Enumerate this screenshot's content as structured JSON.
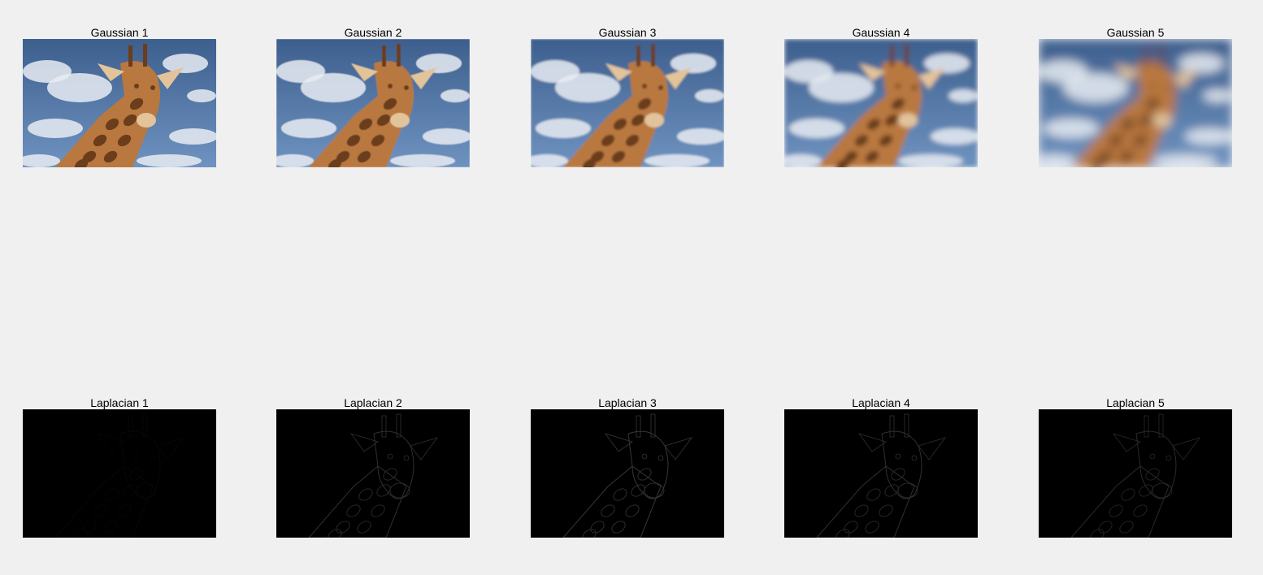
{
  "window": {
    "background": "#f0f0f0"
  },
  "gaussian": [
    {
      "title": "Gaussian 1",
      "level": 1,
      "blur": 0
    },
    {
      "title": "Gaussian 2",
      "level": 2,
      "blur": 0.6
    },
    {
      "title": "Gaussian 3",
      "level": 3,
      "blur": 1.4
    },
    {
      "title": "Gaussian 4",
      "level": 4,
      "blur": 3
    },
    {
      "title": "Gaussian 5",
      "level": 5,
      "blur": 6
    }
  ],
  "laplacian": [
    {
      "title": "Laplacian 1",
      "level": 1,
      "edge_opacity": 0.05
    },
    {
      "title": "Laplacian 2",
      "level": 2,
      "edge_opacity": 0.35
    },
    {
      "title": "Laplacian 3",
      "level": 3,
      "edge_opacity": 0.4
    },
    {
      "title": "Laplacian 4",
      "level": 4,
      "edge_opacity": 0.35
    },
    {
      "title": "Laplacian 5",
      "level": 5,
      "edge_opacity": 0.3
    }
  ],
  "colors": {
    "sky_top": "#3d5f8e",
    "sky_bottom": "#6f93c0",
    "cloud": "#e8ecf2",
    "giraffe": "#b9783f",
    "giraffe_light": "#e3c39a",
    "giraffe_dark": "#6b3d1a",
    "laplacian_bg": "#000000",
    "edge": "#8a8a8a"
  }
}
